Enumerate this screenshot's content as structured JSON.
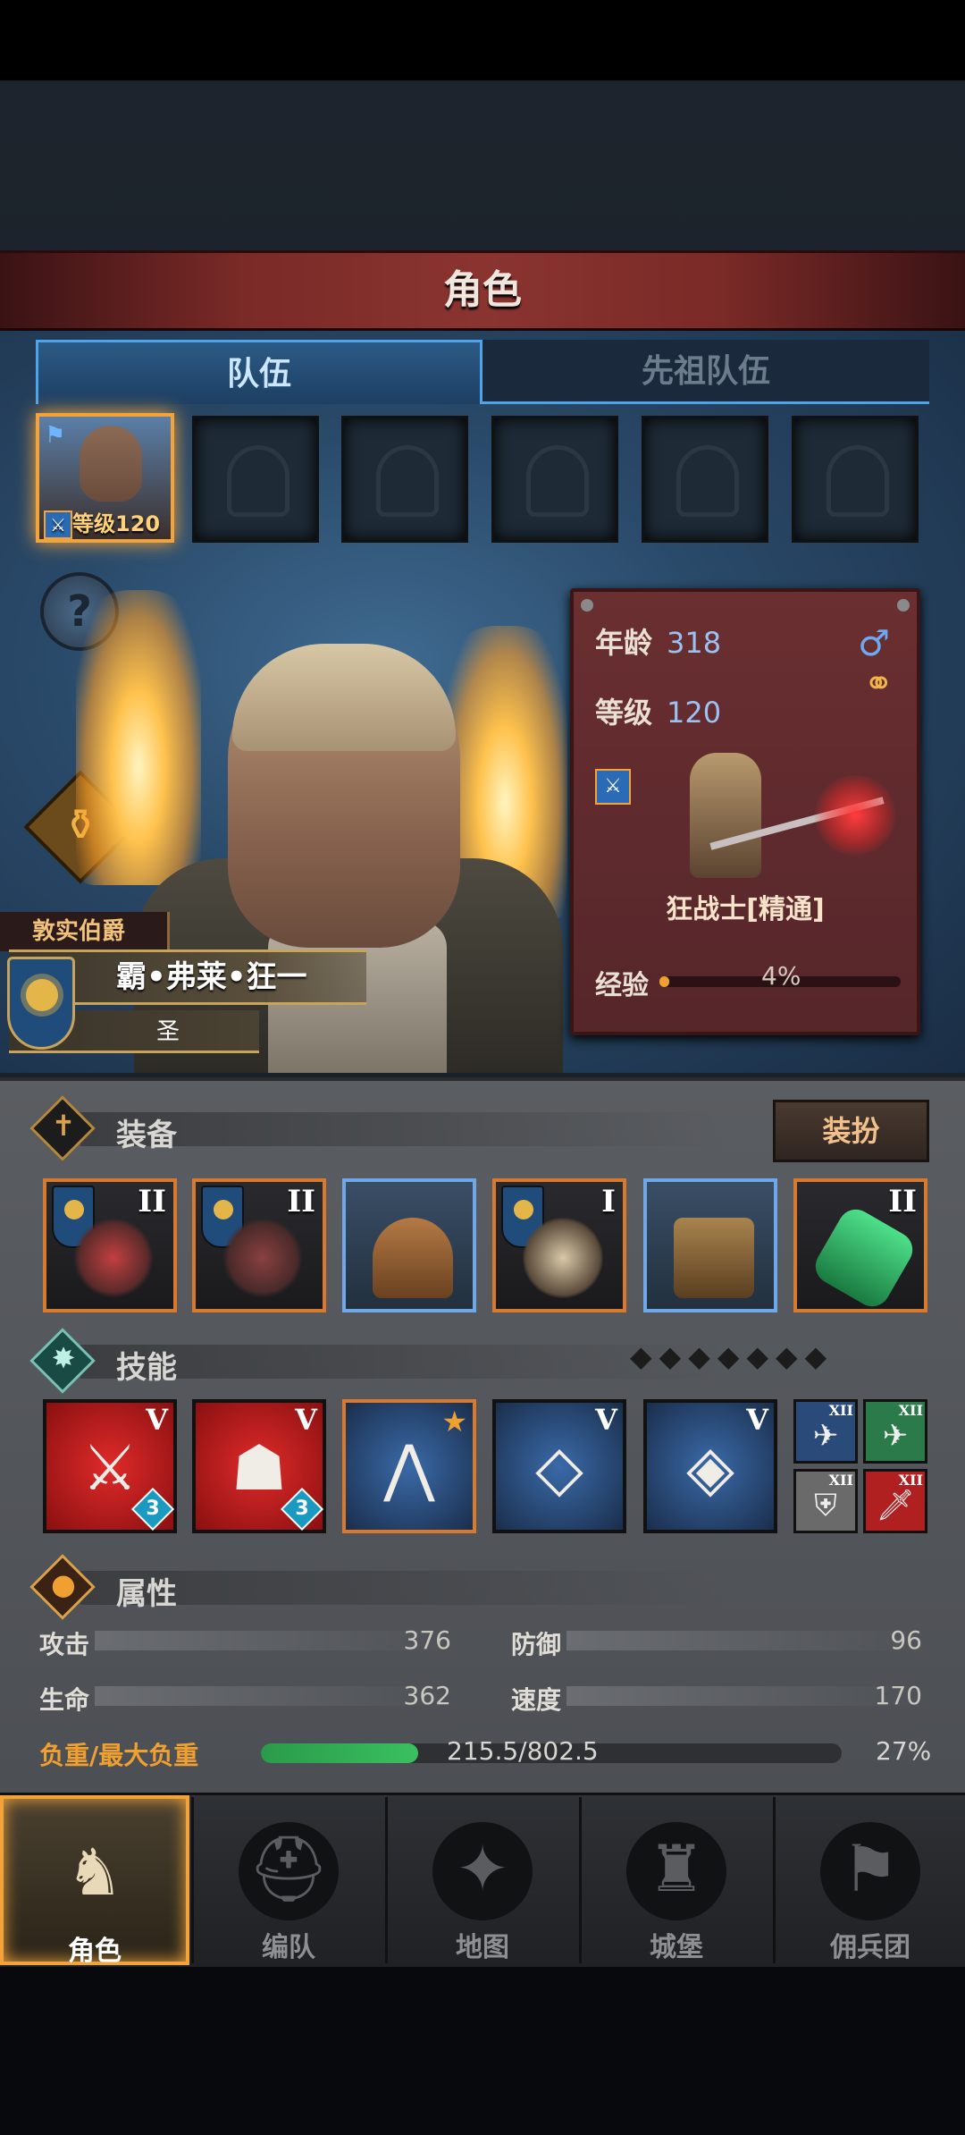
{
  "header": {
    "title": "角色"
  },
  "tabs": [
    {
      "label": "队伍"
    },
    {
      "label": "先祖队伍"
    }
  ],
  "party": {
    "hero_level": "等级120"
  },
  "hero": {
    "rank": "敦实伯爵",
    "name": "霸•弗莱•狂一",
    "title": "圣",
    "age_label": "年龄",
    "age": "318",
    "level_label": "等级",
    "level": "120",
    "class_name": "狂战士[精通]",
    "exp_label": "经验",
    "exp_percent": "4%",
    "exp_fraction": 0.04
  },
  "equipment": {
    "label": "装备",
    "dress_button": "装扮",
    "items": [
      {
        "tier": "II",
        "icon": "morningstar-icon"
      },
      {
        "tier": "II",
        "icon": "morningstar-icon"
      },
      {
        "tier": "",
        "icon": "helmet-icon"
      },
      {
        "tier": "I",
        "icon": "fur-armor-icon"
      },
      {
        "tier": "",
        "icon": "boots-icon"
      },
      {
        "tier": "II",
        "icon": "green-gem-icon"
      }
    ]
  },
  "skills": {
    "label": "技能",
    "items": [
      {
        "tier": "V",
        "badge": "3",
        "icon": "slash-icon"
      },
      {
        "tier": "V",
        "badge": "3",
        "icon": "rally-icon"
      },
      {
        "tier": "",
        "badge": "",
        "icon": "claw-icon"
      },
      {
        "tier": "V",
        "badge": "",
        "icon": "crystal-sword-icon"
      },
      {
        "tier": "V",
        "badge": "",
        "icon": "crystal-beast-icon"
      }
    ],
    "passives": [
      {
        "tier": "XII",
        "icon": "beast-icon"
      },
      {
        "tier": "XII",
        "icon": "beast-green-icon"
      },
      {
        "tier": "XII",
        "icon": "shield-icon"
      },
      {
        "tier": "XII",
        "icon": "sword-icon"
      }
    ]
  },
  "attributes": {
    "label": "属性",
    "attack_label": "攻击",
    "attack": "376",
    "defense_label": "防御",
    "defense": "96",
    "hp_label": "生命",
    "hp": "362",
    "speed_label": "速度",
    "speed": "170",
    "load_label": "负重/最大负重",
    "load": "215.5/802.5",
    "load_percent": "27%",
    "load_fraction": 0.27
  },
  "nav": [
    {
      "label": "角色"
    },
    {
      "label": "编队"
    },
    {
      "label": "地图"
    },
    {
      "label": "城堡"
    },
    {
      "label": "佣兵团"
    }
  ],
  "colors": {
    "accent": "#f2a43b",
    "tab_blue": "#4fa3e8",
    "card": "#6a2f31"
  }
}
